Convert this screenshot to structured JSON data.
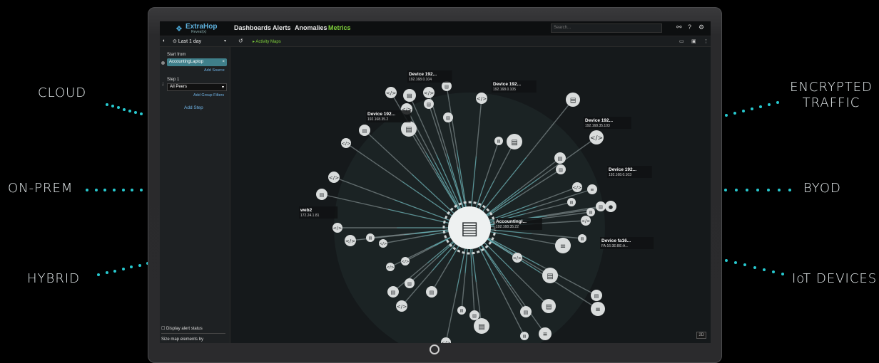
{
  "side_labels": {
    "cloud": "CLOUD",
    "on_prem": "ON-PREM",
    "hybrid": "HYBRID",
    "encrypted_line1": "ENCRYPTED",
    "encrypted_line2": "TRAFFIC",
    "byod": "BYOD",
    "iot": "IoT DEVICES"
  },
  "colors": {
    "accent": "#27c9cf",
    "nav_active": "#7fd13b",
    "link": "#6fb3e6"
  },
  "app": {
    "logo_name": "ExtraHop",
    "logo_sub": "Reveal(x)",
    "nav": [
      "Dashboards",
      "Alerts",
      "Anomalies",
      "Metrics"
    ],
    "nav_active_index": 3,
    "search_placeholder": "Search...",
    "time_range": "Last 1 day",
    "breadcrumb": "Activity Maps"
  },
  "left_panel": {
    "start_from_label": "Start from",
    "start_device": "AccountingLaptop",
    "add_source": "Add Source",
    "step1_label": "Step 1",
    "step1_value": "All Peers",
    "add_group_filters": "Add Group Filters",
    "add_step": "Add Step",
    "display_alert_status": "Display alert status",
    "size_map_label": "Size map elements by"
  },
  "map": {
    "center_label": "Accountingl...",
    "center_ip": "192.168.35.22",
    "labels": [
      {
        "name": "Device 192...",
        "ip": "192.168.0.104"
      },
      {
        "name": "Device 192...",
        "ip": "192.168.0.105"
      },
      {
        "name": "Device 192...",
        "ip": "192.168.35.2"
      },
      {
        "name": "Device 192...",
        "ip": "192.168.35.103"
      },
      {
        "name": "Device 192...",
        "ip": "192.168.0.103"
      },
      {
        "name": "web2",
        "ip": "172.24.1.81"
      },
      {
        "name": "Device fa16...",
        "ip": "FA:16:3E:BE:A..."
      },
      {
        "name": "web1",
        "ip": ""
      }
    ],
    "badge": "2D"
  }
}
